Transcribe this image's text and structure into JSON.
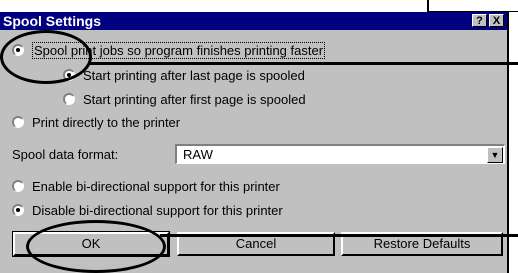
{
  "dialog": {
    "title": "Spool Settings",
    "help_label": "?",
    "close_label": "X",
    "option_spool": "Spool print jobs so program finishes printing faster",
    "option_after_last": "Start printing after last page is spooled",
    "option_after_first": "Start printing after first page is spooled",
    "option_direct": "Print directly to the printer",
    "format_label": "Spool data format:",
    "format_value": "RAW",
    "option_bidi_enable": "Enable bi-directional support for this printer",
    "option_bidi_disable": "Disable bi-directional support for this printer",
    "ok_label": "OK",
    "cancel_label": "Cancel",
    "restore_label": "Restore Defaults"
  },
  "icons": {
    "dropdown": "chevron-down-icon",
    "help": "help-icon",
    "close": "close-icon"
  },
  "colors": {
    "titlebar": "#000080",
    "dialog_bg": "#c0c0c0",
    "annotation": "#000000"
  }
}
